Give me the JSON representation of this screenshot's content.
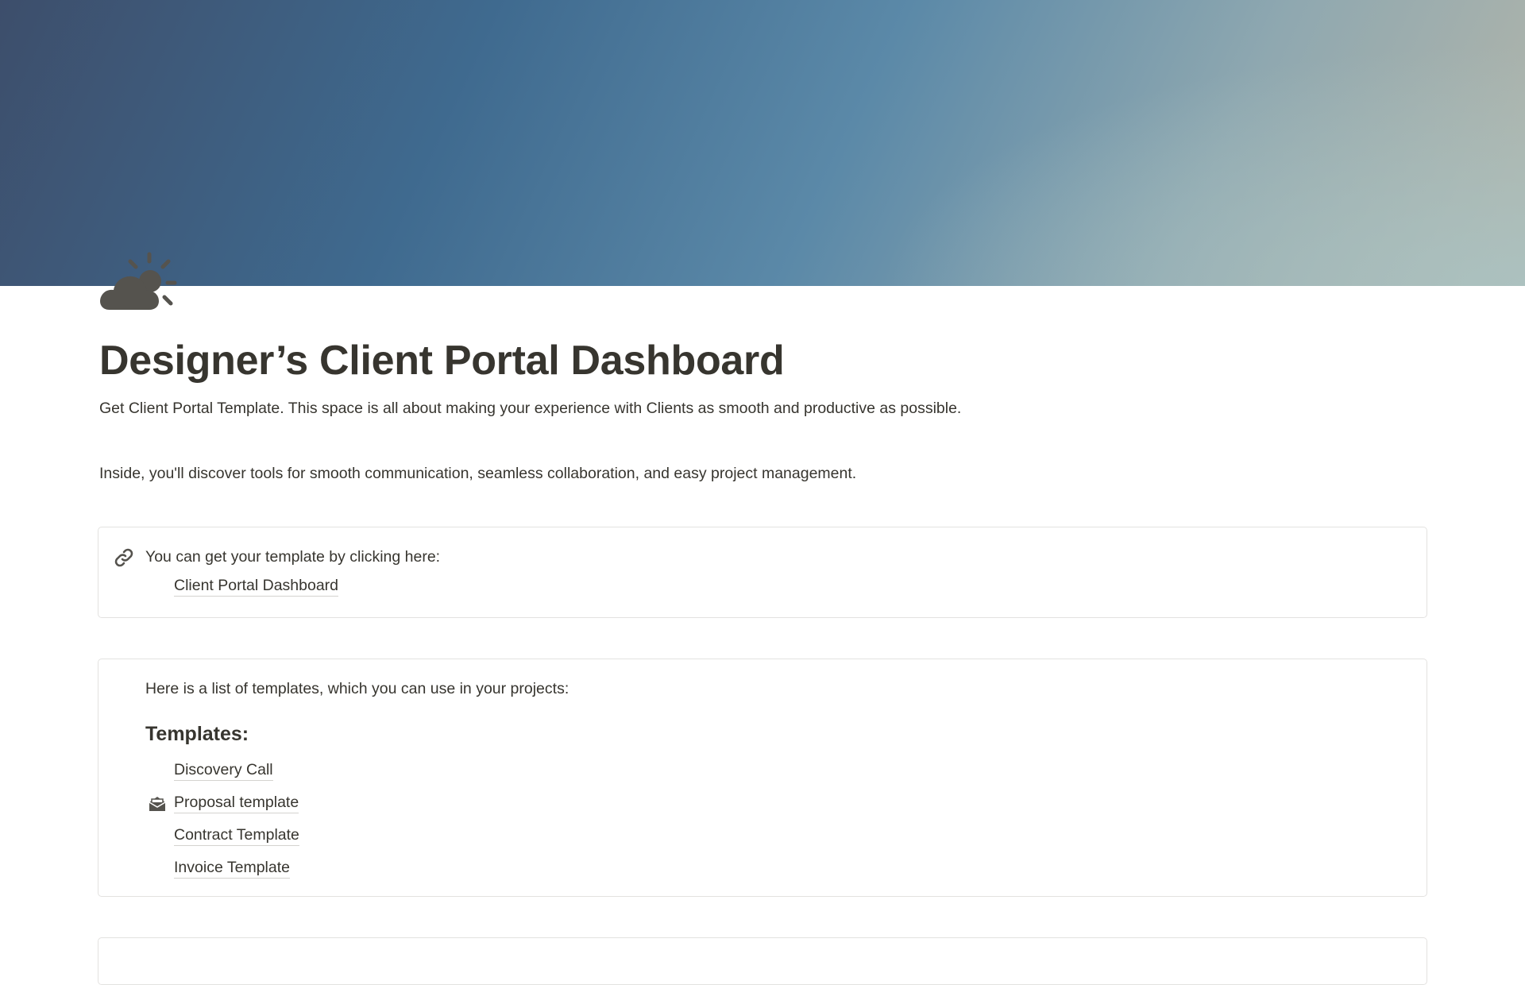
{
  "page": {
    "title": "Designer’s Client Portal Dashboard",
    "icon": "cloud-sun-icon",
    "cover_colors": [
      "#3d4e6b",
      "#3f6a8f",
      "#5b89a8",
      "#8fa8b0",
      "#b4b6aa"
    ]
  },
  "intro": {
    "line1": "Get Client Portal Template. This space is all about making your experience with Clients as smooth and productive as possible.",
    "line2": "Inside, you'll discover tools for smooth communication, seamless collaboration, and easy project management."
  },
  "template_callout": {
    "icon": "link-icon",
    "text": "You can get your template by clicking here:",
    "link_label": "Client Portal Dashboard"
  },
  "templates_callout": {
    "text": "Here is a list of templates, which you can use in your projects:",
    "heading": "Templates:",
    "items": [
      {
        "label": "Discovery Call",
        "icon": ""
      },
      {
        "label": "Proposal template",
        "icon": "open-envelope-icon"
      },
      {
        "label": "Contract Template",
        "icon": ""
      },
      {
        "label": "Invoice Template",
        "icon": ""
      }
    ]
  },
  "colors": {
    "text": "#37352f",
    "border": "#e3e2e0",
    "icon": "#55534e"
  }
}
